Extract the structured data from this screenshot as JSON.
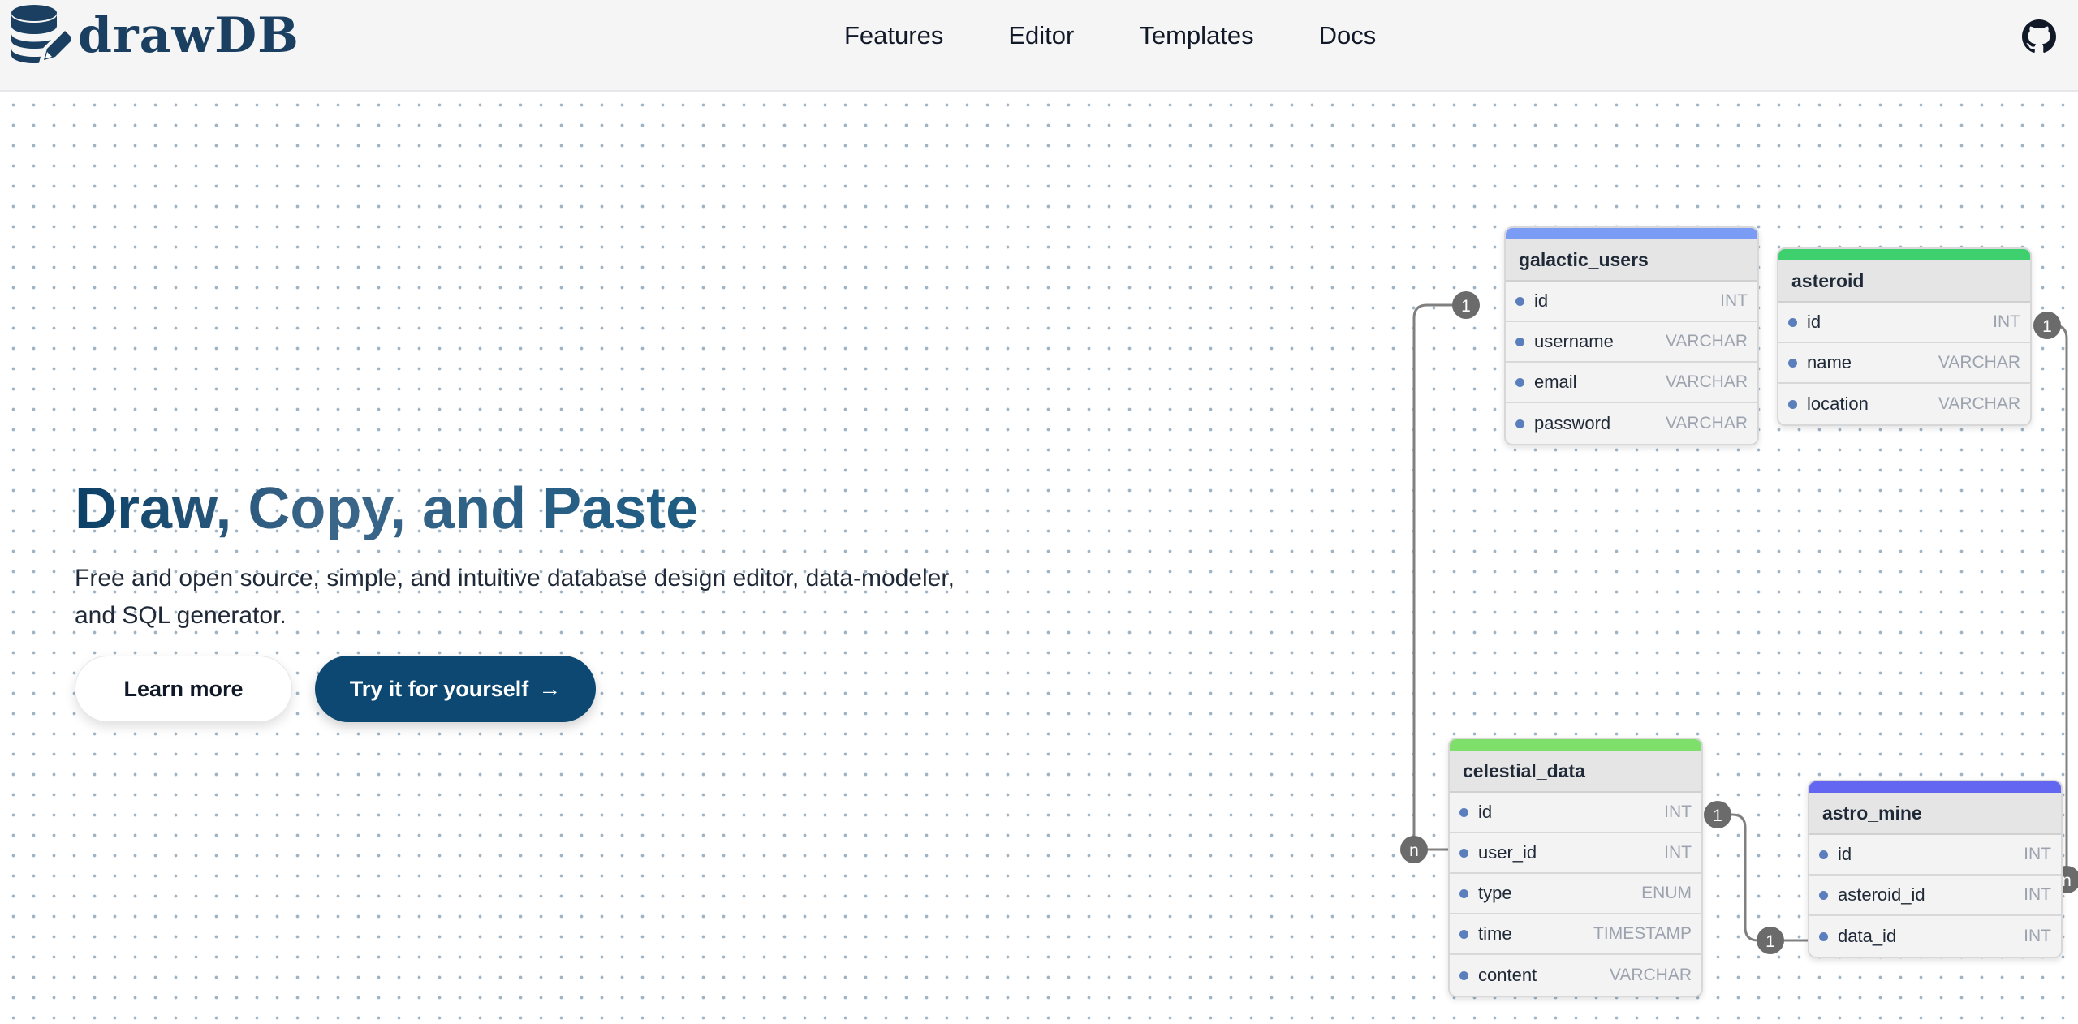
{
  "brand": {
    "name": "drawDB"
  },
  "nav": {
    "links": [
      "Features",
      "Editor",
      "Templates",
      "Docs"
    ]
  },
  "hero": {
    "title": "Draw, Copy, and Paste",
    "subtitle_line1": "Free and open source, simple, and intuitive database design editor, data-modeler,",
    "subtitle_line2": "and SQL generator.",
    "learn_more": "Learn more",
    "try_it": "Try it for yourself",
    "try_arrow": "→"
  },
  "colors": {
    "brand": "#1b3f61",
    "primary_button": "#0d4873",
    "galactic_users": "#7b9cf5",
    "asteroid": "#3ecf6e",
    "celestial_data": "#7ee06a",
    "astro_mine": "#6366f1"
  },
  "tables": {
    "galactic_users": {
      "name": "galactic_users",
      "fields": [
        {
          "name": "id",
          "type": "INT"
        },
        {
          "name": "username",
          "type": "VARCHAR"
        },
        {
          "name": "email",
          "type": "VARCHAR"
        },
        {
          "name": "password",
          "type": "VARCHAR"
        }
      ]
    },
    "asteroid": {
      "name": "asteroid",
      "fields": [
        {
          "name": "id",
          "type": "INT"
        },
        {
          "name": "name",
          "type": "VARCHAR"
        },
        {
          "name": "location",
          "type": "VARCHAR"
        }
      ]
    },
    "celestial_data": {
      "name": "celestial_data",
      "fields": [
        {
          "name": "id",
          "type": "INT"
        },
        {
          "name": "user_id",
          "type": "INT"
        },
        {
          "name": "type",
          "type": "ENUM"
        },
        {
          "name": "time",
          "type": "TIMESTAMP"
        },
        {
          "name": "content",
          "type": "VARCHAR"
        }
      ]
    },
    "astro_mine": {
      "name": "astro_mine",
      "fields": [
        {
          "name": "id",
          "type": "INT"
        },
        {
          "name": "asteroid_id",
          "type": "INT"
        },
        {
          "name": "data_id",
          "type": "INT"
        }
      ]
    }
  },
  "cardinality": {
    "one": "1",
    "many": "n"
  }
}
